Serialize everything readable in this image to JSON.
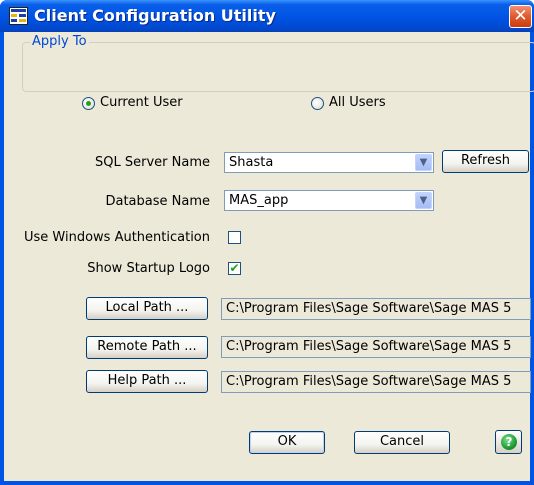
{
  "window": {
    "title": "Client Configuration Utility",
    "close_glyph": "✕"
  },
  "apply_to": {
    "legend": "Apply To",
    "options": [
      {
        "label": "Current User",
        "selected": true
      },
      {
        "label": "All Users",
        "selected": false
      }
    ]
  },
  "form": {
    "sql_server_label": "SQL Server Name",
    "sql_server_value": "Shasta",
    "refresh_label": "Refresh",
    "database_label": "Database Name",
    "database_value": "MAS_app",
    "windows_auth_label": "Use Windows Authentication",
    "windows_auth_checked": false,
    "startup_logo_label": "Show Startup Logo",
    "startup_logo_checked": true,
    "check_glyph": "✔"
  },
  "paths": {
    "local_label": "Local Path ...",
    "local_value": "C:\\Program Files\\Sage Software\\Sage MAS 5",
    "remote_label": "Remote Path ...",
    "remote_value": "C:\\Program Files\\Sage Software\\Sage MAS 5",
    "help_label": "Help Path ...",
    "help_value": "C:\\Program Files\\Sage Software\\Sage MAS 5"
  },
  "footer": {
    "ok_label": "OK",
    "cancel_label": "Cancel",
    "help_glyph": "?"
  },
  "icons": {
    "app": "app-grid-icon",
    "close": "close-icon",
    "dropdown": "chevron-down-icon",
    "help": "help-icon"
  },
  "colors": {
    "titlebar": "#0055e5",
    "dialog_bg": "#ece9d8",
    "legend_text": "#0046d5",
    "close_button": "#e05a2c",
    "check_mark": "#21a121"
  }
}
